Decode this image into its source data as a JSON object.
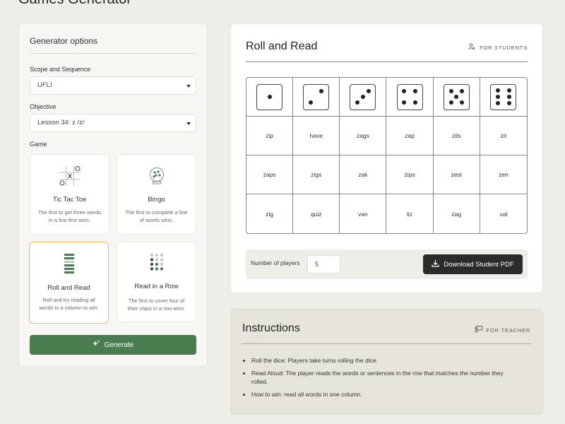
{
  "page_title": "Games Generator",
  "sidebar": {
    "title": "Generator options",
    "scope_label": "Scope and Sequence",
    "scope_value": "UFLI",
    "objective_label": "Objective",
    "objective_value": "Lesson 34: z /z/",
    "game_label": "Game",
    "games": [
      {
        "name": "Tic Tac Toe",
        "desc": "The first to get three words in a line first wins.",
        "selected": false
      },
      {
        "name": "Bingo",
        "desc": "The first to complete a line of words wins.",
        "selected": false
      },
      {
        "name": "Roll and Read",
        "desc": "Roll and try reading all words in a column to win.",
        "selected": true
      },
      {
        "name": "Read in a Row",
        "desc": "The first to cover four of their chips in a row wins.",
        "selected": false
      }
    ],
    "generate_label": "Generate"
  },
  "game": {
    "title": "Roll and Read",
    "badge": "FOR STUDENTS",
    "dice": [
      1,
      2,
      3,
      4,
      5,
      6
    ],
    "rows": [
      [
        "zip",
        "have",
        "zags",
        "zap",
        "zits",
        "zit"
      ],
      [
        "zaps",
        "zigs",
        "zak",
        "zips",
        "zest",
        "zen"
      ],
      [
        "zig",
        "quiz",
        "van",
        "liz",
        "zag",
        "val"
      ]
    ],
    "players_label": "Number of players",
    "players_value": "5",
    "download_label": "Download Student PDF"
  },
  "instructions": {
    "title": "Instructions",
    "badge": "FOR TEACHER",
    "items": [
      "Roll the dice: Players take turns rolling the dice.",
      "Read Aloud: The player reads the words or sentences in the row that matches the number they rolled.",
      "How to win: read all words in one column."
    ]
  },
  "colors": {
    "accent_green": "#497d4f",
    "selected_border": "#f1b45a",
    "dark_button": "#2b2b2b"
  }
}
